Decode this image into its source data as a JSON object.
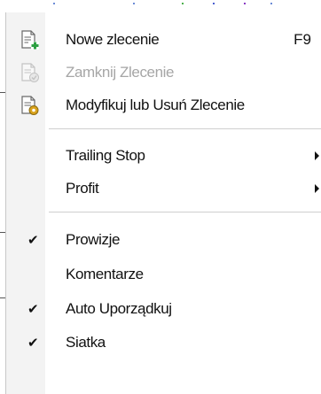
{
  "menu": {
    "items": [
      {
        "label": "Nowe zlecenie",
        "shortcut": "F9",
        "icon": "new-order-icon",
        "enabled": true
      },
      {
        "label": "Zamknij Zlecenie",
        "icon": "close-order-icon",
        "enabled": false
      },
      {
        "label": "Modyfikuj lub Usuń Zlecenie",
        "icon": "modify-order-icon",
        "enabled": true
      },
      {
        "label": "Trailing Stop",
        "submenu": true,
        "enabled": true
      },
      {
        "label": "Profit",
        "submenu": true,
        "enabled": true
      },
      {
        "label": "Prowizje",
        "checked": true,
        "enabled": true
      },
      {
        "label": "Komentarze",
        "checked": false,
        "enabled": true
      },
      {
        "label": "Auto Uporządkuj",
        "checked": true,
        "enabled": true
      },
      {
        "label": "Siatka",
        "checked": true,
        "enabled": true
      }
    ],
    "check_glyph": "✔"
  },
  "colors": {
    "text": "#111111",
    "disabled_text": "#a6a6a6",
    "gutter": "#f3f3f3",
    "icon_green": "#2ea043",
    "icon_gold": "#d9a21b"
  }
}
